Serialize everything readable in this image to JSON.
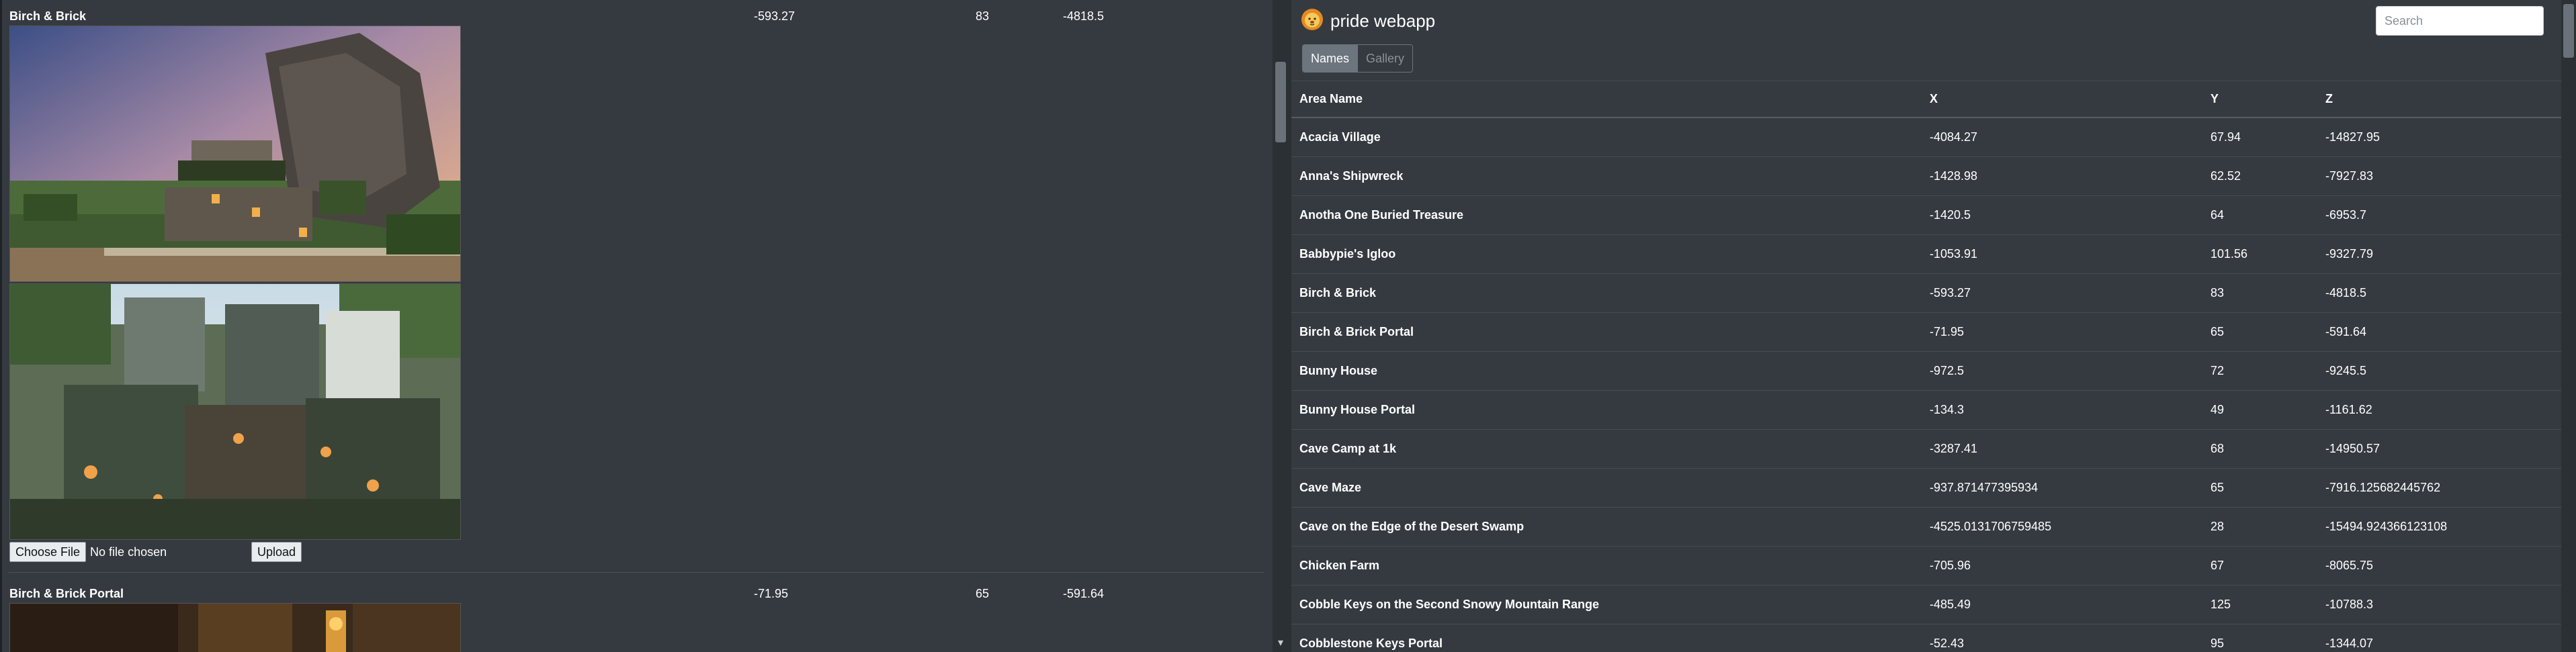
{
  "gallery": {
    "areas": [
      {
        "name": "Birch & Brick",
        "x": "-593.27",
        "y": "83",
        "z": "-4818.5"
      },
      {
        "name": "Birch & Brick Portal",
        "x": "-71.95",
        "y": "65",
        "z": "-591.64"
      }
    ],
    "file_input": {
      "button_label": "Choose File",
      "status": "No file chosen"
    },
    "upload_label": "Upload"
  },
  "app": {
    "brand": "pride webapp",
    "search_placeholder": "Search",
    "tabs": [
      {
        "label": "Names",
        "active": true
      },
      {
        "label": "Gallery",
        "active": false
      }
    ]
  },
  "table": {
    "headers": [
      "Area Name",
      "X",
      "Y",
      "Z"
    ],
    "rows": [
      [
        "Acacia Village",
        "-4084.27",
        "67.94",
        "-14827.95"
      ],
      [
        "Anna's Shipwreck",
        "-1428.98",
        "62.52",
        "-7927.83"
      ],
      [
        "Anotha One Buried Treasure",
        "-1420.5",
        "64",
        "-6953.7"
      ],
      [
        "Babbypie's Igloo",
        "-1053.91",
        "101.56",
        "-9327.79"
      ],
      [
        "Birch & Brick",
        "-593.27",
        "83",
        "-4818.5"
      ],
      [
        "Birch & Brick Portal",
        "-71.95",
        "65",
        "-591.64"
      ],
      [
        "Bunny House",
        "-972.5",
        "72",
        "-9245.5"
      ],
      [
        "Bunny House Portal",
        "-134.3",
        "49",
        "-1161.62"
      ],
      [
        "Cave Camp at 1k",
        "-3287.41",
        "68",
        "-14950.57"
      ],
      [
        "Cave Maze",
        "-937.871477395934",
        "65",
        "-7916.125682445762"
      ],
      [
        "Cave on the Edge of the Desert Swamp",
        "-4525.0131706759485",
        "28",
        "-15494.924366123108"
      ],
      [
        "Chicken Farm",
        "-705.96",
        "67",
        "-8065.75"
      ],
      [
        "Cobble Keys on the Second Snowy Mountain Range",
        "-485.49",
        "125",
        "-10788.3"
      ],
      [
        "Cobblestone Keys Portal",
        "-52.43",
        "95",
        "-1344.07"
      ]
    ]
  },
  "colors": {
    "background": "#343a40",
    "active_tab": "#6c757d",
    "text": "#ffffff"
  },
  "icons": {
    "brand_logo": "lion-face-icon"
  }
}
